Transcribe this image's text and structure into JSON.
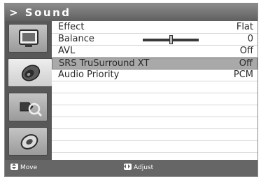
{
  "menu": {
    "title": "> Sound",
    "sidebar": {
      "items": [
        {
          "icon": "picture-icon",
          "active": false
        },
        {
          "icon": "sound-icon",
          "active": true
        },
        {
          "icon": "setup-icon",
          "active": false
        },
        {
          "icon": "input-icon",
          "active": false
        }
      ]
    },
    "rows": [
      {
        "label": "Effect",
        "value": "Flat"
      },
      {
        "label": "Balance",
        "value": "0",
        "slider_level": 0.5
      },
      {
        "label": "AVL",
        "value": "Off"
      },
      {
        "label": "SRS TruSurround XT",
        "value": "Off",
        "selected": true
      },
      {
        "label": "Audio Priority",
        "value": "PCM"
      }
    ],
    "footer": {
      "move_label": "Move",
      "adjust_label": "Adjust"
    }
  }
}
